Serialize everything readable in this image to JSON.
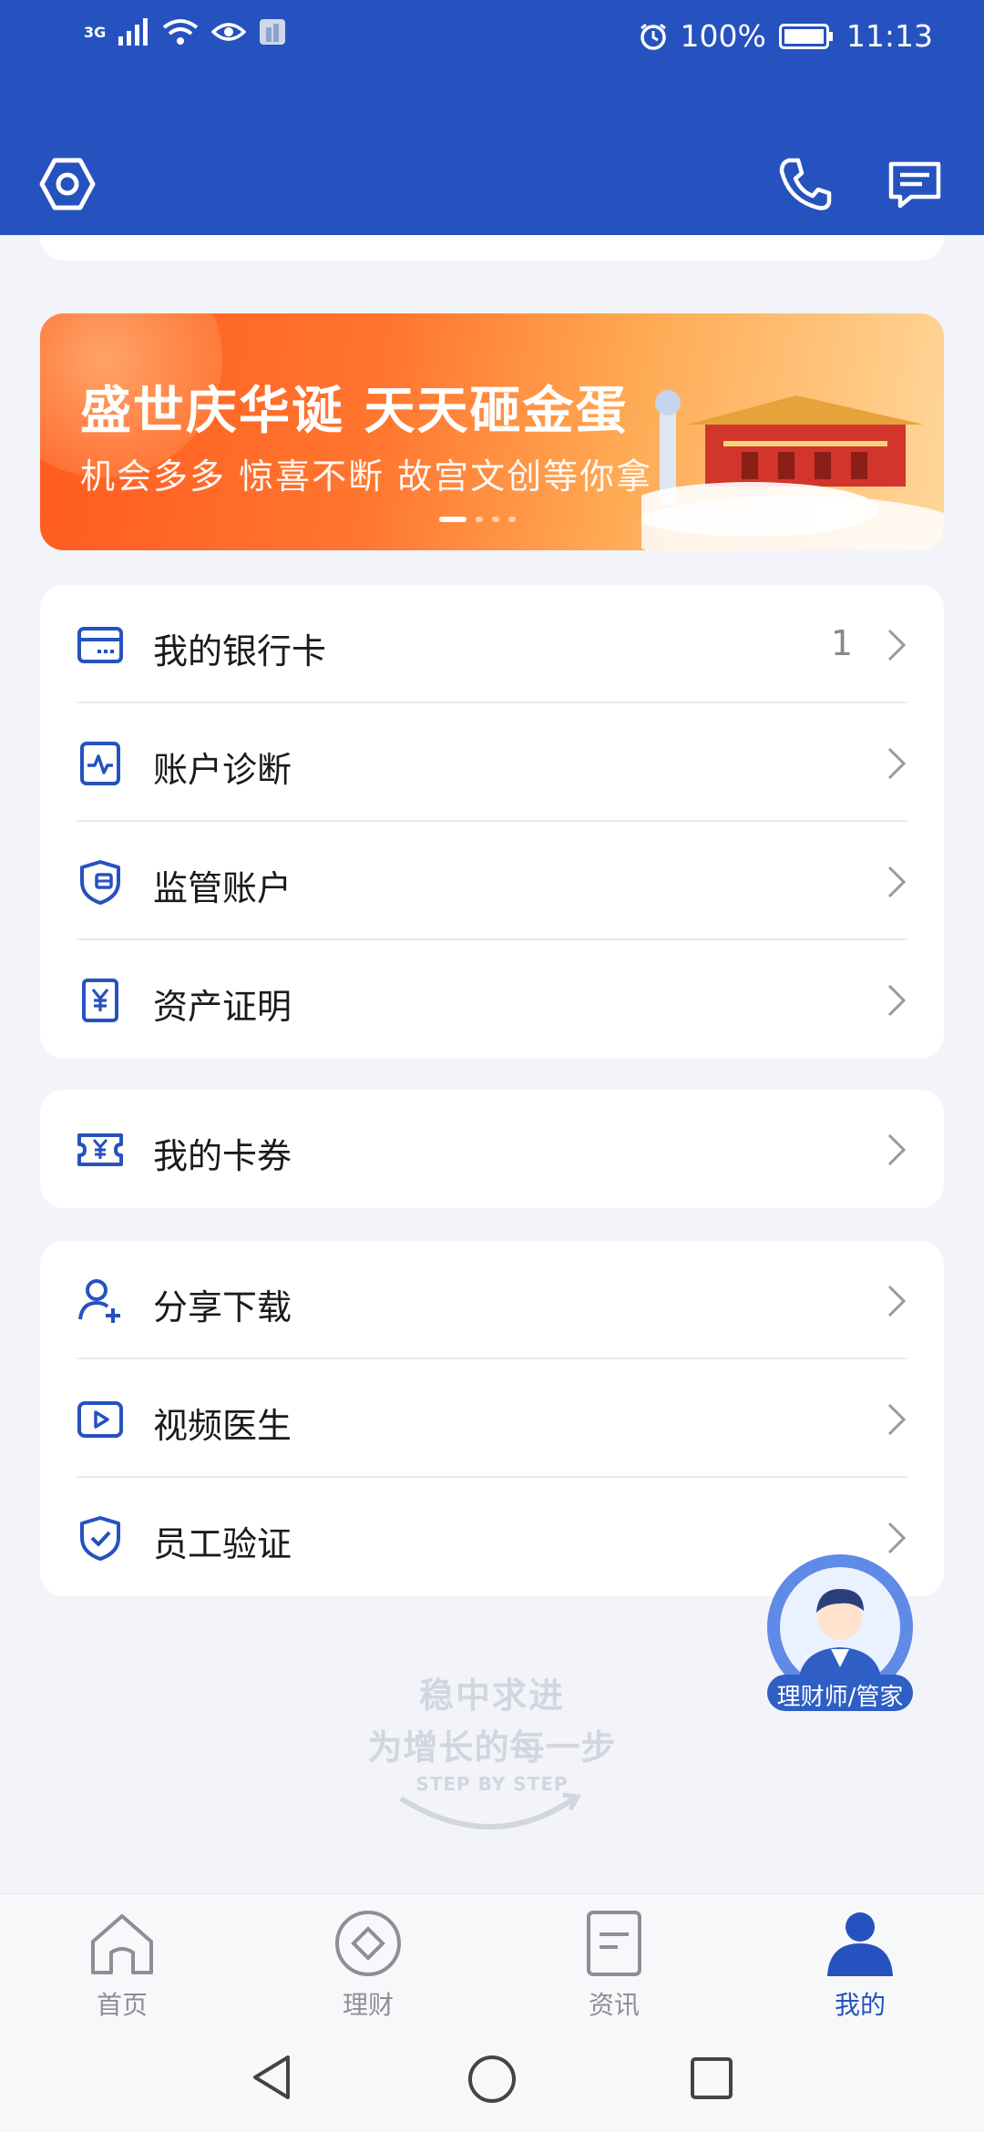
{
  "status_bar": {
    "network": "3G",
    "battery": "100%",
    "time": "11:13"
  },
  "banner": {
    "title": "盛世庆华诞 天天砸金蛋",
    "subtitle": "机会多多  惊喜不断  故宫文创等你拿"
  },
  "menu_group_1": [
    {
      "label": "我的银行卡",
      "count": "1",
      "icon": "bank-card-icon"
    },
    {
      "label": "账户诊断",
      "icon": "account-diagnosis-icon"
    },
    {
      "label": "监管账户",
      "icon": "supervised-account-icon"
    },
    {
      "label": "资产证明",
      "icon": "asset-certificate-icon"
    }
  ],
  "menu_group_2": [
    {
      "label": "我的卡券",
      "icon": "coupon-icon"
    }
  ],
  "menu_group_3": [
    {
      "label": "分享下载",
      "icon": "share-user-icon"
    },
    {
      "label": "视频医生",
      "icon": "video-doctor-icon"
    },
    {
      "label": "员工验证",
      "icon": "employee-verify-icon"
    }
  ],
  "advisor_button": {
    "label": "理财师/管家"
  },
  "slogan": {
    "line1": "稳中求进",
    "line2": "为增长的每一步",
    "line3": "STEP BY STEP"
  },
  "tabs": [
    {
      "label": "首页",
      "icon": "home-icon",
      "active": false
    },
    {
      "label": "理财",
      "icon": "wealth-icon",
      "active": false
    },
    {
      "label": "资讯",
      "icon": "news-icon",
      "active": false
    },
    {
      "label": "我的",
      "icon": "profile-icon",
      "active": true
    }
  ],
  "colors": {
    "brand": "#2652bf",
    "background": "#f2f4fa"
  }
}
